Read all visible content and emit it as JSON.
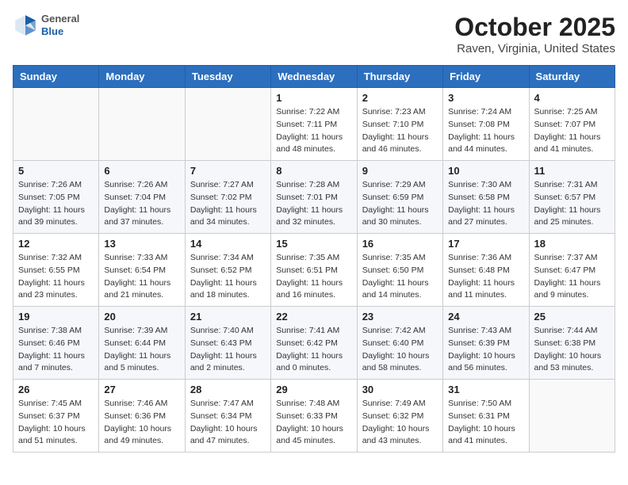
{
  "logo": {
    "general": "General",
    "blue": "Blue"
  },
  "header": {
    "month_title": "October 2025",
    "location": "Raven, Virginia, United States"
  },
  "days_of_week": [
    "Sunday",
    "Monday",
    "Tuesday",
    "Wednesday",
    "Thursday",
    "Friday",
    "Saturday"
  ],
  "weeks": [
    [
      {
        "day": "",
        "info": ""
      },
      {
        "day": "",
        "info": ""
      },
      {
        "day": "",
        "info": ""
      },
      {
        "day": "1",
        "info": "Sunrise: 7:22 AM\nSunset: 7:11 PM\nDaylight: 11 hours\nand 48 minutes."
      },
      {
        "day": "2",
        "info": "Sunrise: 7:23 AM\nSunset: 7:10 PM\nDaylight: 11 hours\nand 46 minutes."
      },
      {
        "day": "3",
        "info": "Sunrise: 7:24 AM\nSunset: 7:08 PM\nDaylight: 11 hours\nand 44 minutes."
      },
      {
        "day": "4",
        "info": "Sunrise: 7:25 AM\nSunset: 7:07 PM\nDaylight: 11 hours\nand 41 minutes."
      }
    ],
    [
      {
        "day": "5",
        "info": "Sunrise: 7:26 AM\nSunset: 7:05 PM\nDaylight: 11 hours\nand 39 minutes."
      },
      {
        "day": "6",
        "info": "Sunrise: 7:26 AM\nSunset: 7:04 PM\nDaylight: 11 hours\nand 37 minutes."
      },
      {
        "day": "7",
        "info": "Sunrise: 7:27 AM\nSunset: 7:02 PM\nDaylight: 11 hours\nand 34 minutes."
      },
      {
        "day": "8",
        "info": "Sunrise: 7:28 AM\nSunset: 7:01 PM\nDaylight: 11 hours\nand 32 minutes."
      },
      {
        "day": "9",
        "info": "Sunrise: 7:29 AM\nSunset: 6:59 PM\nDaylight: 11 hours\nand 30 minutes."
      },
      {
        "day": "10",
        "info": "Sunrise: 7:30 AM\nSunset: 6:58 PM\nDaylight: 11 hours\nand 27 minutes."
      },
      {
        "day": "11",
        "info": "Sunrise: 7:31 AM\nSunset: 6:57 PM\nDaylight: 11 hours\nand 25 minutes."
      }
    ],
    [
      {
        "day": "12",
        "info": "Sunrise: 7:32 AM\nSunset: 6:55 PM\nDaylight: 11 hours\nand 23 minutes."
      },
      {
        "day": "13",
        "info": "Sunrise: 7:33 AM\nSunset: 6:54 PM\nDaylight: 11 hours\nand 21 minutes."
      },
      {
        "day": "14",
        "info": "Sunrise: 7:34 AM\nSunset: 6:52 PM\nDaylight: 11 hours\nand 18 minutes."
      },
      {
        "day": "15",
        "info": "Sunrise: 7:35 AM\nSunset: 6:51 PM\nDaylight: 11 hours\nand 16 minutes."
      },
      {
        "day": "16",
        "info": "Sunrise: 7:35 AM\nSunset: 6:50 PM\nDaylight: 11 hours\nand 14 minutes."
      },
      {
        "day": "17",
        "info": "Sunrise: 7:36 AM\nSunset: 6:48 PM\nDaylight: 11 hours\nand 11 minutes."
      },
      {
        "day": "18",
        "info": "Sunrise: 7:37 AM\nSunset: 6:47 PM\nDaylight: 11 hours\nand 9 minutes."
      }
    ],
    [
      {
        "day": "19",
        "info": "Sunrise: 7:38 AM\nSunset: 6:46 PM\nDaylight: 11 hours\nand 7 minutes."
      },
      {
        "day": "20",
        "info": "Sunrise: 7:39 AM\nSunset: 6:44 PM\nDaylight: 11 hours\nand 5 minutes."
      },
      {
        "day": "21",
        "info": "Sunrise: 7:40 AM\nSunset: 6:43 PM\nDaylight: 11 hours\nand 2 minutes."
      },
      {
        "day": "22",
        "info": "Sunrise: 7:41 AM\nSunset: 6:42 PM\nDaylight: 11 hours\nand 0 minutes."
      },
      {
        "day": "23",
        "info": "Sunrise: 7:42 AM\nSunset: 6:40 PM\nDaylight: 10 hours\nand 58 minutes."
      },
      {
        "day": "24",
        "info": "Sunrise: 7:43 AM\nSunset: 6:39 PM\nDaylight: 10 hours\nand 56 minutes."
      },
      {
        "day": "25",
        "info": "Sunrise: 7:44 AM\nSunset: 6:38 PM\nDaylight: 10 hours\nand 53 minutes."
      }
    ],
    [
      {
        "day": "26",
        "info": "Sunrise: 7:45 AM\nSunset: 6:37 PM\nDaylight: 10 hours\nand 51 minutes."
      },
      {
        "day": "27",
        "info": "Sunrise: 7:46 AM\nSunset: 6:36 PM\nDaylight: 10 hours\nand 49 minutes."
      },
      {
        "day": "28",
        "info": "Sunrise: 7:47 AM\nSunset: 6:34 PM\nDaylight: 10 hours\nand 47 minutes."
      },
      {
        "day": "29",
        "info": "Sunrise: 7:48 AM\nSunset: 6:33 PM\nDaylight: 10 hours\nand 45 minutes."
      },
      {
        "day": "30",
        "info": "Sunrise: 7:49 AM\nSunset: 6:32 PM\nDaylight: 10 hours\nand 43 minutes."
      },
      {
        "day": "31",
        "info": "Sunrise: 7:50 AM\nSunset: 6:31 PM\nDaylight: 10 hours\nand 41 minutes."
      },
      {
        "day": "",
        "info": ""
      }
    ]
  ]
}
